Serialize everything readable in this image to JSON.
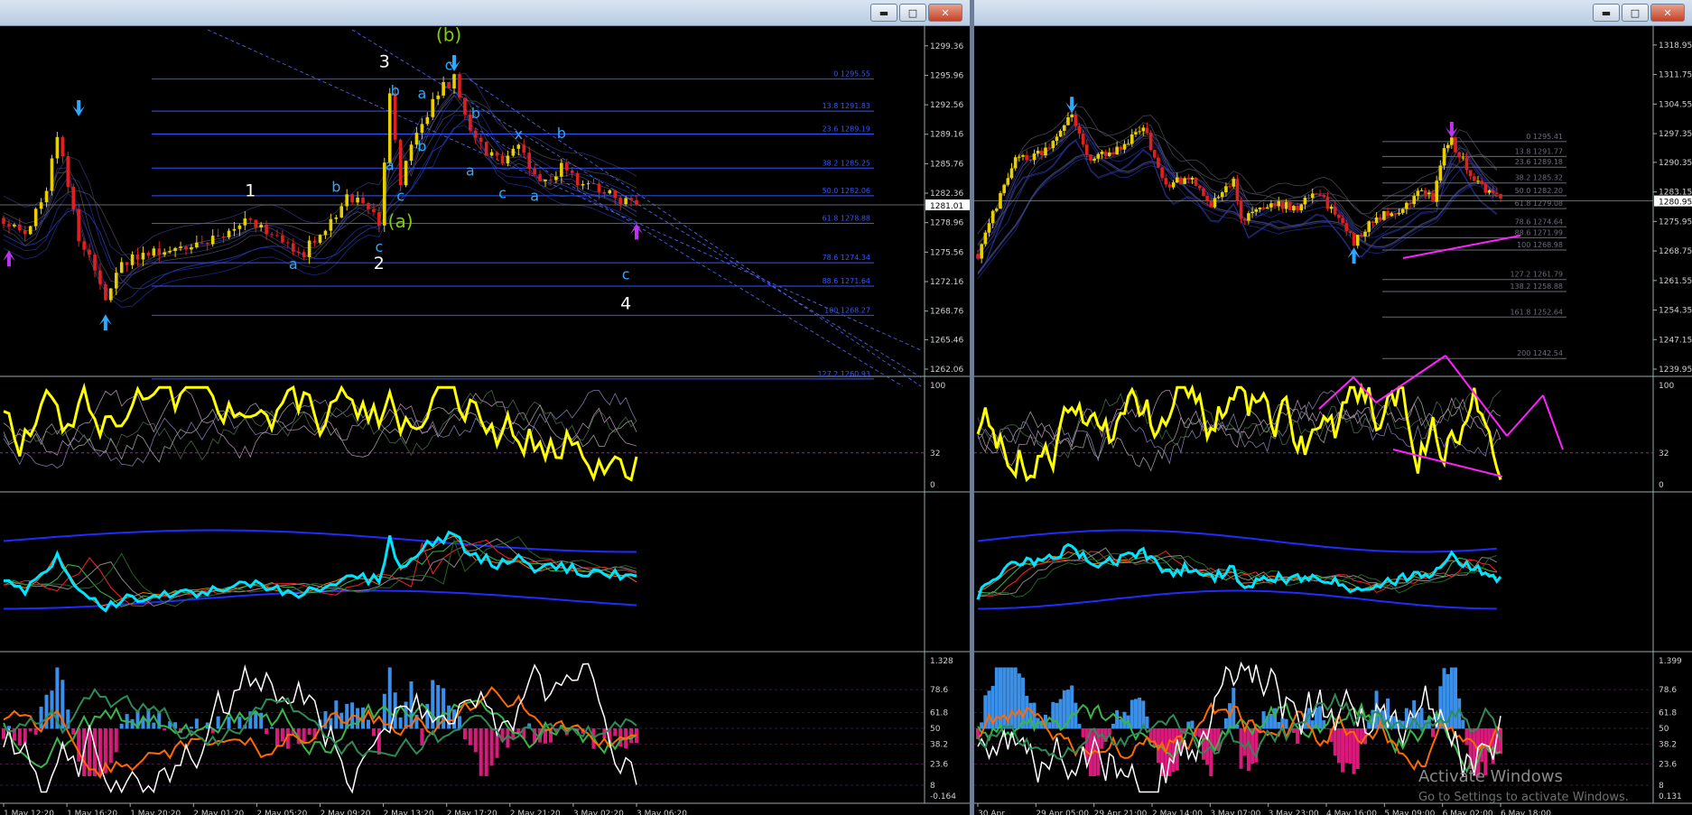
{
  "colors": {
    "background": "#000000",
    "price_up": "#e8d000",
    "price_down": "#e02020",
    "wave_label": "#2fa8ff",
    "fib": "#3355ff",
    "stoch": "#ffff00",
    "cci": "#00e5ff",
    "histo_up": "#3a8fe8",
    "histo_down": "#d81b7a",
    "annotation": "#ff22ff",
    "axis_text": "#d0d0d0"
  },
  "icons": {
    "minimize": "minimize-icon",
    "maximize": "maximize-icon",
    "close": "close-icon",
    "arrow_up": "arrow-up-icon",
    "arrow_down": "arrow-down-icon"
  },
  "window_buttons": {
    "minimize": "▬",
    "maximize": "□",
    "close": "✕"
  },
  "left_window": {
    "price_axis": [
      "1299.36",
      "1295.96",
      "1292.56",
      "1289.16",
      "1285.76",
      "1282.36",
      "1278.96",
      "1275.56",
      "1272.16",
      "1268.76",
      "1265.46",
      "1262.06"
    ],
    "current_price": "1281.01",
    "fib_levels": [
      {
        "label": "0 1295.55",
        "price": 1295.55
      },
      {
        "label": "13.8 1291.83",
        "price": 1291.83
      },
      {
        "label": "23.6 1289.19",
        "price": 1289.19
      },
      {
        "label": "38.2 1285.25",
        "price": 1285.25
      },
      {
        "label": "50.0 1282.06",
        "price": 1282.06
      },
      {
        "label": "61.8 1278.88",
        "price": 1278.88
      },
      {
        "label": "78.6 1274.34",
        "price": 1274.34
      },
      {
        "label": "88.6 1271.64",
        "price": 1271.64
      },
      {
        "label": "100 1268.27",
        "price": 1268.27
      },
      {
        "label": "127.2 1260.93",
        "price": 1260.93
      }
    ],
    "wave_labels": [
      {
        "text": "(b)",
        "price": 1299.9,
        "bar": 83,
        "color": "#7fd000",
        "size": 20
      },
      {
        "text": "3",
        "price": 1296.9,
        "bar": 71,
        "color": "#ffffff",
        "size": 19
      },
      {
        "text": "c",
        "price": 1296.6,
        "bar": 83,
        "color": "#2fa8ff",
        "size": 16
      },
      {
        "text": "b",
        "price": 1293.6,
        "bar": 73,
        "color": "#2fa8ff",
        "size": 16
      },
      {
        "text": "a",
        "price": 1293.3,
        "bar": 78,
        "color": "#2fa8ff",
        "size": 16
      },
      {
        "text": "b",
        "price": 1291.0,
        "bar": 88,
        "color": "#2fa8ff",
        "size": 16
      },
      {
        "text": "x",
        "price": 1288.6,
        "bar": 96,
        "color": "#2fa8ff",
        "size": 16
      },
      {
        "text": "b",
        "price": 1288.7,
        "bar": 104,
        "color": "#2fa8ff",
        "size": 16
      },
      {
        "text": "b",
        "price": 1287.2,
        "bar": 78,
        "color": "#2fa8ff",
        "size": 16
      },
      {
        "text": "a",
        "price": 1285.0,
        "bar": 72,
        "color": "#2fa8ff",
        "size": 16
      },
      {
        "text": "a",
        "price": 1284.4,
        "bar": 87,
        "color": "#2fa8ff",
        "size": 16
      },
      {
        "text": "1",
        "price": 1282.0,
        "bar": 46,
        "color": "#ffffff",
        "size": 19
      },
      {
        "text": "b",
        "price": 1282.5,
        "bar": 62,
        "color": "#2fa8ff",
        "size": 16
      },
      {
        "text": "c",
        "price": 1281.5,
        "bar": 74,
        "color": "#2fa8ff",
        "size": 16
      },
      {
        "text": "c",
        "price": 1281.8,
        "bar": 93,
        "color": "#2fa8ff",
        "size": 16
      },
      {
        "text": "a",
        "price": 1281.5,
        "bar": 99,
        "color": "#2fa8ff",
        "size": 16
      },
      {
        "text": "(a)",
        "price": 1278.4,
        "bar": 74,
        "color": "#7fd000",
        "size": 20
      },
      {
        "text": "c",
        "price": 1275.6,
        "bar": 70,
        "color": "#2fa8ff",
        "size": 16
      },
      {
        "text": "a",
        "price": 1273.6,
        "bar": 54,
        "color": "#2fa8ff",
        "size": 16
      },
      {
        "text": "2",
        "price": 1273.6,
        "bar": 70,
        "color": "#ffffff",
        "size": 19
      },
      {
        "text": "c",
        "price": 1272.4,
        "bar": 116,
        "color": "#2fa8ff",
        "size": 16
      },
      {
        "text": "4",
        "price": 1269.0,
        "bar": 116,
        "color": "#ffffff",
        "size": 19
      }
    ],
    "time_axis": [
      "1 May 12:20",
      "1 May 16:20",
      "1 May 20:20",
      "2 May 01:20",
      "2 May 05:20",
      "2 May 09:20",
      "2 May 13:20",
      "2 May 17:20",
      "2 May 21:20",
      "3 May 02:20",
      "3 May 06:20"
    ],
    "stoch_axis": [
      "100",
      "32",
      "0"
    ],
    "osc_axis": [
      "1.328",
      "78.6",
      "61.8",
      "50",
      "38.2",
      "23.6",
      "8",
      "-0.164"
    ]
  },
  "right_window": {
    "price_axis": [
      "1318.95",
      "1311.75",
      "1304.55",
      "1297.35",
      "1290.35",
      "1283.15",
      "1275.95",
      "1268.75",
      "1261.55",
      "1254.35",
      "1247.15",
      "1239.95"
    ],
    "current_price": "1280.95",
    "fib_levels": [
      {
        "label": "0 1295.41",
        "price": 1295.41
      },
      {
        "label": "13.8 1291.77",
        "price": 1291.77
      },
      {
        "label": "23.6 1289.18",
        "price": 1289.18
      },
      {
        "label": "38.2 1285.32",
        "price": 1285.32
      },
      {
        "label": "50.0 1282.20",
        "price": 1282.2
      },
      {
        "label": "61.8 1279.08",
        "price": 1279.08
      },
      {
        "label": "78.6 1274.64",
        "price": 1274.64
      },
      {
        "label": "88.6 1271.99",
        "price": 1271.99
      },
      {
        "label": "100 1268.98",
        "price": 1268.98
      },
      {
        "label": "127.2 1261.79",
        "price": 1261.79
      },
      {
        "label": "138.2 1258.88",
        "price": 1258.88
      },
      {
        "label": "161.8 1252.64",
        "price": 1252.64
      },
      {
        "label": "200 1242.54",
        "price": 1242.54
      }
    ],
    "time_axis": [
      "30 Apr",
      "29 Apr 05:00",
      "29 Apr 21:00",
      "2 May 14:00",
      "3 May 07:00",
      "3 May 23:00",
      "4 May 16:00",
      "5 May 09:00",
      "6 May 02:00",
      "6 May 18:00"
    ],
    "stoch_axis": [
      "100",
      "32",
      "0"
    ],
    "osc_axis": [
      "1.399",
      "78.6",
      "61.8",
      "50",
      "38.2",
      "23.6",
      "8",
      "0.131"
    ]
  },
  "watermark": {
    "title": "Activate Windows",
    "subtitle": "Go to Settings to activate Windows."
  },
  "chart_data": [
    {
      "type": "candlestick",
      "title": "",
      "xlabel": "",
      "ylabel": "",
      "ylim": [
        1262.06,
        1300.9
      ],
      "x": [
        "1 May 12:20",
        "1 May 16:20",
        "1 May 20:20",
        "2 May 01:20",
        "2 May 05:20",
        "2 May 09:20",
        "2 May 13:20",
        "2 May 17:20",
        "2 May 21:20",
        "3 May 02:20",
        "3 May 06:20"
      ],
      "price_path": [
        [
          0,
          1279.5
        ],
        [
          4,
          1277.0
        ],
        [
          8,
          1283.0
        ],
        [
          10,
          1289.0
        ],
        [
          14,
          1277.5
        ],
        [
          19,
          1270.5
        ],
        [
          22,
          1274.0
        ],
        [
          28,
          1275.8
        ],
        [
          36,
          1276.5
        ],
        [
          42,
          1277.5
        ],
        [
          46,
          1279.2
        ],
        [
          52,
          1277.0
        ],
        [
          56,
          1275.6
        ],
        [
          61,
          1279.0
        ],
        [
          64,
          1281.8
        ],
        [
          69,
          1280.5
        ],
        [
          70,
          1278.8
        ],
        [
          72,
          1294.0
        ],
        [
          74,
          1283.5
        ],
        [
          77,
          1290.0
        ],
        [
          82,
          1294.5
        ],
        [
          84,
          1295.5
        ],
        [
          87,
          1289.0
        ],
        [
          92,
          1286.0
        ],
        [
          96,
          1287.5
        ],
        [
          100,
          1283.7
        ],
        [
          104,
          1285.2
        ],
        [
          108,
          1283.5
        ],
        [
          112,
          1283.0
        ],
        [
          118,
          1280.6
        ]
      ],
      "bars": 119,
      "grid": false
    },
    {
      "type": "candlestick",
      "title": "",
      "xlabel": "",
      "ylabel": "",
      "ylim": [
        1239.95,
        1322.0
      ],
      "x": [
        "30 Apr",
        "29 Apr 05:00",
        "29 Apr 21:00",
        "2 May 14:00",
        "3 May 07:00",
        "3 May 23:00",
        "4 May 16:00",
        "5 May 09:00",
        "6 May 02:00",
        "6 May 18:00"
      ],
      "price_path": [
        [
          0,
          1268.0
        ],
        [
          5,
          1280.0
        ],
        [
          10,
          1291.0
        ],
        [
          18,
          1293.0
        ],
        [
          25,
          1301.5
        ],
        [
          30,
          1291.0
        ],
        [
          38,
          1293.5
        ],
        [
          44,
          1299.0
        ],
        [
          50,
          1284.5
        ],
        [
          56,
          1287.0
        ],
        [
          62,
          1279.5
        ],
        [
          68,
          1286.0
        ],
        [
          70,
          1276.0
        ],
        [
          78,
          1281.0
        ],
        [
          84,
          1279.0
        ],
        [
          90,
          1283.0
        ],
        [
          96,
          1276.5
        ],
        [
          100,
          1271.0
        ],
        [
          106,
          1277.0
        ],
        [
          112,
          1279.0
        ],
        [
          118,
          1283.5
        ],
        [
          121,
          1281.5
        ],
        [
          124,
          1294.0
        ],
        [
          126,
          1295.4
        ],
        [
          132,
          1286.0
        ],
        [
          139,
          1280.95
        ]
      ],
      "bars": 140,
      "grid": false
    }
  ]
}
